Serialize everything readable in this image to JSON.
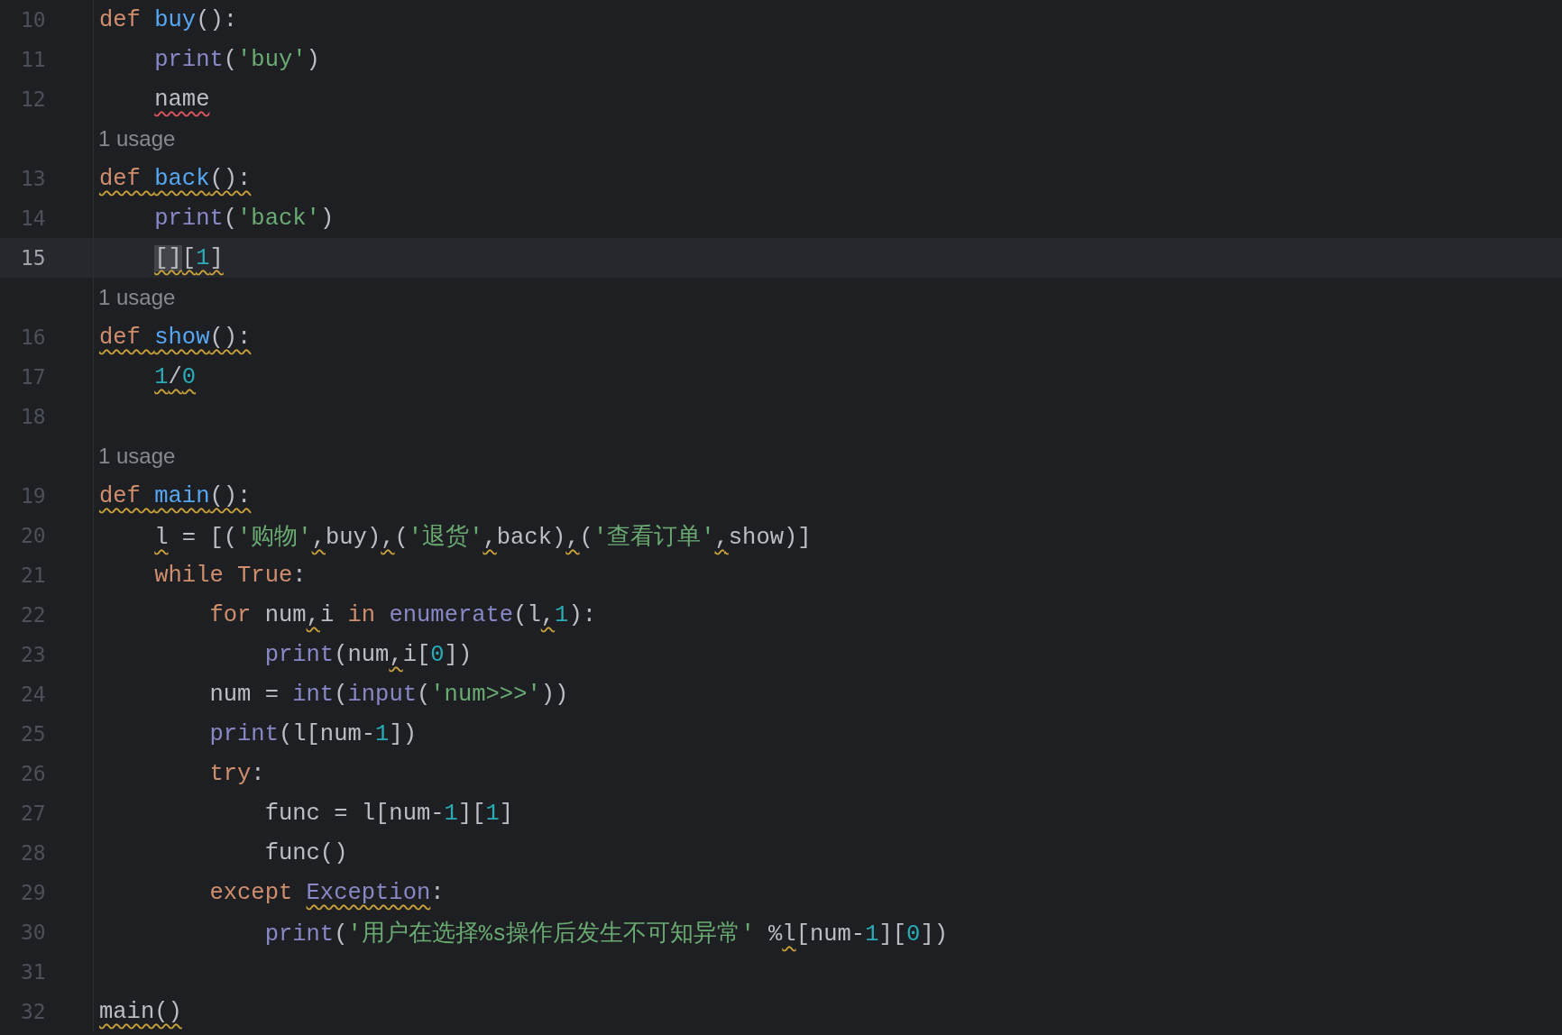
{
  "lines": [
    {
      "kind": "code",
      "number": "10",
      "current": false,
      "tokens": [
        {
          "kind": "keyword",
          "text": "def "
        },
        {
          "kind": "function",
          "text": "buy"
        },
        {
          "kind": "plain",
          "text": "():"
        }
      ]
    },
    {
      "kind": "code",
      "number": "11",
      "current": false,
      "tokens": [
        {
          "kind": "builtin",
          "text": "    print"
        },
        {
          "kind": "plain",
          "text": "("
        },
        {
          "kind": "string",
          "text": "'buy'"
        },
        {
          "kind": "plain",
          "text": ")"
        }
      ]
    },
    {
      "kind": "code",
      "number": "12",
      "current": false,
      "tokens": [
        {
          "kind": "plain",
          "text": "    name",
          "error": true
        }
      ]
    },
    {
      "kind": "hint",
      "text": "1 usage"
    },
    {
      "kind": "code",
      "number": "13",
      "current": false,
      "tokens": [
        {
          "kind": "keyword",
          "text": "def ",
          "warning": true
        },
        {
          "kind": "function",
          "text": "back",
          "warning": true
        },
        {
          "kind": "plain",
          "text": "():",
          "warning": true
        }
      ]
    },
    {
      "kind": "code",
      "number": "14",
      "current": false,
      "tokens": [
        {
          "kind": "builtin",
          "text": "    print"
        },
        {
          "kind": "plain",
          "text": "("
        },
        {
          "kind": "string",
          "text": "'back'"
        },
        {
          "kind": "plain",
          "text": ")"
        }
      ]
    },
    {
      "kind": "code",
      "number": "15",
      "current": true,
      "tokens": [
        {
          "kind": "plain",
          "text": "    []",
          "warning": true,
          "highlight": true
        },
        {
          "kind": "plain",
          "text": "[",
          "warning": true
        },
        {
          "kind": "number",
          "text": "1",
          "warning": true
        },
        {
          "kind": "plain",
          "text": "]",
          "warning": true
        }
      ]
    },
    {
      "kind": "hint",
      "text": "1 usage"
    },
    {
      "kind": "code",
      "number": "16",
      "current": false,
      "tokens": [
        {
          "kind": "keyword",
          "text": "def ",
          "warning": true
        },
        {
          "kind": "function",
          "text": "show",
          "warning": true
        },
        {
          "kind": "plain",
          "text": "():",
          "warning": true
        }
      ]
    },
    {
      "kind": "code",
      "number": "17",
      "current": false,
      "tokens": [
        {
          "kind": "number",
          "text": "    1",
          "warning": true
        },
        {
          "kind": "plain",
          "text": "/",
          "warning": true
        },
        {
          "kind": "number",
          "text": "0",
          "warning": true
        }
      ]
    },
    {
      "kind": "code",
      "number": "18",
      "current": false
    },
    {
      "kind": "hint",
      "text": "1 usage"
    },
    {
      "kind": "code",
      "number": "19",
      "current": false,
      "tokens": [
        {
          "kind": "keyword",
          "text": "def ",
          "warning": true
        },
        {
          "kind": "function",
          "text": "main",
          "warning": true
        },
        {
          "kind": "plain",
          "text": "():",
          "warning": true
        }
      ]
    },
    {
      "kind": "code",
      "number": "20",
      "current": false,
      "tokens": [
        {
          "kind": "plain",
          "text": "    l",
          "warning": true
        },
        {
          "kind": "plain",
          "text": " = [("
        },
        {
          "kind": "string",
          "text": "'购物'"
        },
        {
          "kind": "plain",
          "text": ",",
          "warning": true
        },
        {
          "kind": "plain",
          "text": "buy)"
        },
        {
          "kind": "plain",
          "text": ",",
          "warning": true
        },
        {
          "kind": "plain",
          "text": "("
        },
        {
          "kind": "string",
          "text": "'退货'"
        },
        {
          "kind": "plain",
          "text": ",",
          "warning": true
        },
        {
          "kind": "plain",
          "text": "back)"
        },
        {
          "kind": "plain",
          "text": ",",
          "warning": true
        },
        {
          "kind": "plain",
          "text": "("
        },
        {
          "kind": "string",
          "text": "'查看订单'"
        },
        {
          "kind": "plain",
          "text": ",",
          "warning": true
        },
        {
          "kind": "plain",
          "text": "show)]"
        }
      ]
    },
    {
      "kind": "code",
      "number": "21",
      "current": false,
      "tokens": [
        {
          "kind": "keyword",
          "text": "    while True"
        },
        {
          "kind": "plain",
          "text": ":"
        }
      ]
    },
    {
      "kind": "code",
      "number": "22",
      "current": false,
      "tokens": [
        {
          "kind": "keyword",
          "text": "        for"
        },
        {
          "kind": "plain",
          "text": " num"
        },
        {
          "kind": "plain",
          "text": ",",
          "warning": true
        },
        {
          "kind": "plain",
          "text": "i "
        },
        {
          "kind": "keyword",
          "text": "in "
        },
        {
          "kind": "builtin",
          "text": "enumerate"
        },
        {
          "kind": "plain",
          "text": "(l"
        },
        {
          "kind": "plain",
          "text": ",",
          "warning": true
        },
        {
          "kind": "number",
          "text": "1"
        },
        {
          "kind": "plain",
          "text": "):"
        }
      ]
    },
    {
      "kind": "code",
      "number": "23",
      "current": false,
      "tokens": [
        {
          "kind": "builtin",
          "text": "            print"
        },
        {
          "kind": "plain",
          "text": "(num"
        },
        {
          "kind": "plain",
          "text": ",",
          "warning": true
        },
        {
          "kind": "plain",
          "text": "i["
        },
        {
          "kind": "number",
          "text": "0"
        },
        {
          "kind": "plain",
          "text": "])"
        }
      ]
    },
    {
      "kind": "code",
      "number": "24",
      "current": false,
      "tokens": [
        {
          "kind": "plain",
          "text": "        num = "
        },
        {
          "kind": "builtin",
          "text": "int"
        },
        {
          "kind": "plain",
          "text": "("
        },
        {
          "kind": "builtin",
          "text": "input"
        },
        {
          "kind": "plain",
          "text": "("
        },
        {
          "kind": "string",
          "text": "'num>>>'"
        },
        {
          "kind": "plain",
          "text": "))"
        }
      ]
    },
    {
      "kind": "code",
      "number": "25",
      "current": false,
      "tokens": [
        {
          "kind": "builtin",
          "text": "        print"
        },
        {
          "kind": "plain",
          "text": "(l[num-"
        },
        {
          "kind": "number",
          "text": "1"
        },
        {
          "kind": "plain",
          "text": "])"
        }
      ]
    },
    {
      "kind": "code",
      "number": "26",
      "current": false,
      "tokens": [
        {
          "kind": "keyword",
          "text": "        try"
        },
        {
          "kind": "plain",
          "text": ":"
        }
      ]
    },
    {
      "kind": "code",
      "number": "27",
      "current": false,
      "tokens": [
        {
          "kind": "plain",
          "text": "            func = l[num-"
        },
        {
          "kind": "number",
          "text": "1"
        },
        {
          "kind": "plain",
          "text": "]["
        },
        {
          "kind": "number",
          "text": "1"
        },
        {
          "kind": "plain",
          "text": "]"
        }
      ]
    },
    {
      "kind": "code",
      "number": "28",
      "current": false,
      "tokens": [
        {
          "kind": "plain",
          "text": "            func()"
        }
      ]
    },
    {
      "kind": "code",
      "number": "29",
      "current": false,
      "tokens": [
        {
          "kind": "keyword",
          "text": "        except "
        },
        {
          "kind": "builtin",
          "text": "Exception",
          "warning": true
        },
        {
          "kind": "plain",
          "text": ":"
        }
      ]
    },
    {
      "kind": "code",
      "number": "30",
      "current": false,
      "tokens": [
        {
          "kind": "builtin",
          "text": "            print"
        },
        {
          "kind": "plain",
          "text": "("
        },
        {
          "kind": "string",
          "text": "'用户在选择%s操作后发生不可知异常'"
        },
        {
          "kind": "plain",
          "text": " %"
        },
        {
          "kind": "plain",
          "text": "l",
          "warning": true
        },
        {
          "kind": "plain",
          "text": "[num-"
        },
        {
          "kind": "number",
          "text": "1"
        },
        {
          "kind": "plain",
          "text": "]["
        },
        {
          "kind": "number",
          "text": "0"
        },
        {
          "kind": "plain",
          "text": "])"
        }
      ]
    },
    {
      "kind": "code",
      "number": "31",
      "current": false
    },
    {
      "kind": "code",
      "number": "32",
      "current": false,
      "tokens": [
        {
          "kind": "plain",
          "text": "main()",
          "warning": true
        }
      ]
    }
  ]
}
